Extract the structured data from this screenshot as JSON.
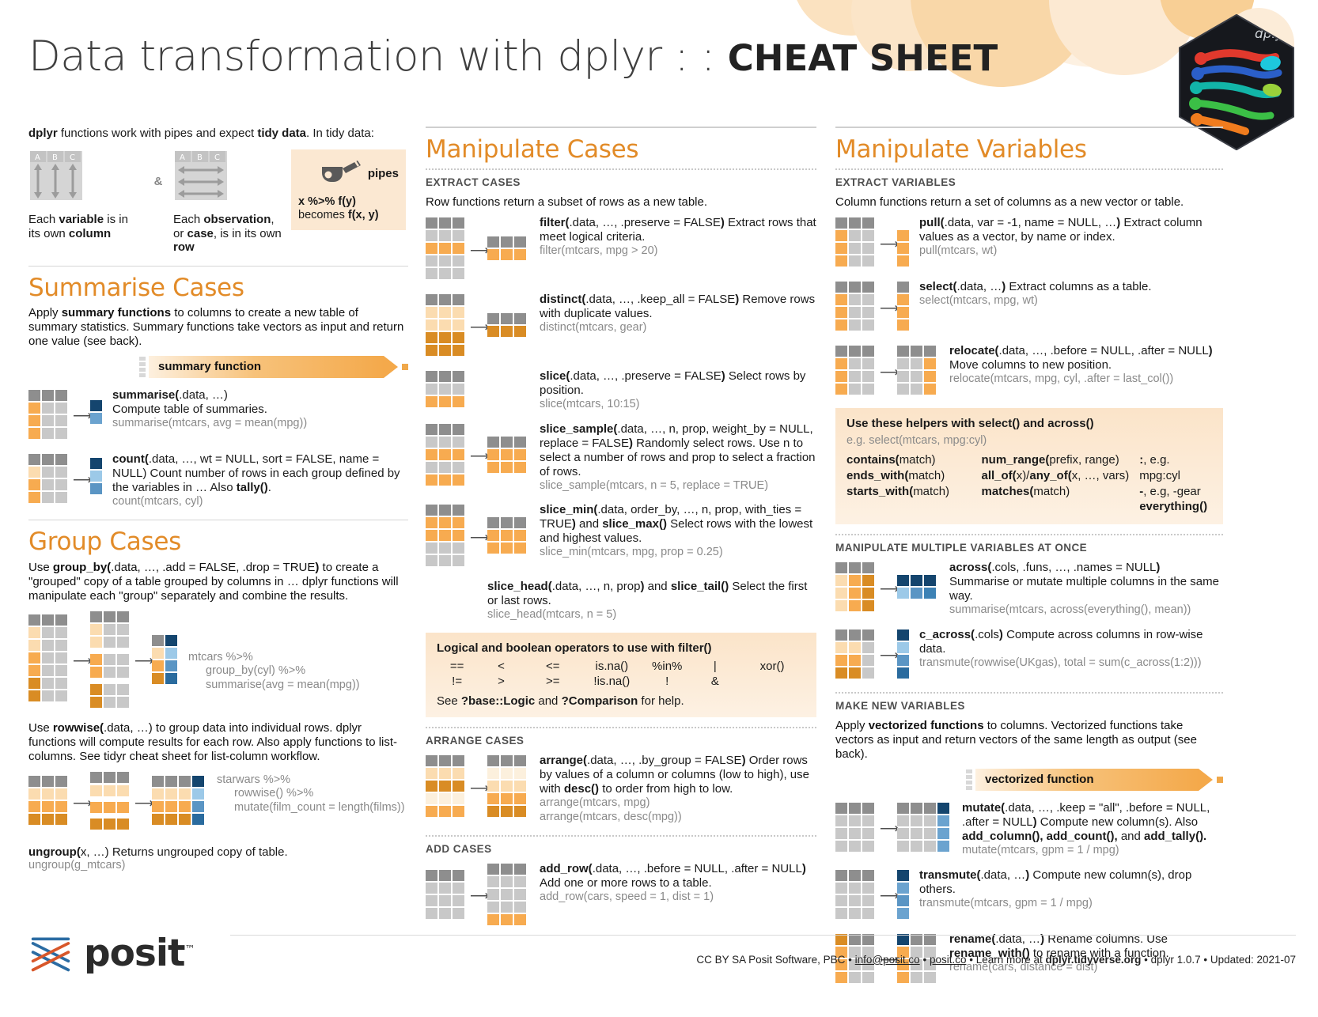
{
  "header": {
    "title_light": "Data transformation with dplyr : : ",
    "title_bold": "CHEAT SHEET",
    "logo_name": "dplyr-hex-logo"
  },
  "intro": {
    "lead_a": "dplyr",
    "lead_b": " functions work with pipes and expect ",
    "lead_c": "tidy data",
    "lead_d": ". In tidy data:",
    "variable_caption_a": "Each ",
    "variable_caption_b": "variable",
    "variable_caption_c": " is in its own ",
    "variable_caption_d": "column",
    "observation_caption_a": "Each ",
    "observation_caption_b": "observation",
    "observation_caption_c": ", or ",
    "observation_caption_d": "case",
    "observation_caption_e": ", is in its own ",
    "observation_caption_f": "row",
    "amp": "&",
    "pipes_label": "pipes",
    "pipes_line1": "x %>% f(y)",
    "pipes_line2_lite": "becomes  ",
    "pipes_line2_bold": "f(x, y)"
  },
  "summarise": {
    "heading": "Summarise Cases",
    "body_a": "Apply ",
    "body_b": "summary functions",
    "body_c": " to columns to create a new table of summary statistics. Summary functions take vectors as input and return one value (see back).",
    "banner_label": "summary function",
    "entries": [
      {
        "sig_bold": "summarise(",
        "sig_rest": ".data, …)",
        "desc": "Compute table of summaries.",
        "code": "summarise(mtcars, avg = mean(mpg))"
      },
      {
        "sig_bold": "count(",
        "sig_rest": ".data, …, wt = NULL, sort = FALSE, name = NULL",
        "sig_tail": ") Count number of rows in each group defined by the variables in … Also ",
        "sig_tail_bold": "tally()",
        "sig_tail_end": ".",
        "code": "count(mtcars, cyl)"
      }
    ]
  },
  "group": {
    "heading": "Group Cases",
    "body_a": "Use ",
    "body_b": "group_by(",
    "body_c": ".data, …, .add = FALSE, .drop = TRUE",
    "body_d": ")",
    "body_e": " to create a \"grouped\" copy of a table grouped by columns in … dplyr functions will manipulate each \"group\" separately and combine the results.",
    "code1_line1": "mtcars  %>%",
    "code1_line2": "group_by(cyl) %>%",
    "code1_line3": "summarise(avg = mean(mpg))",
    "rowwise_a": "Use ",
    "rowwise_b": "rowwise(",
    "rowwise_c": ".data, …)",
    "rowwise_d": " to group data into individual rows. dplyr functions will compute results for each row. Also apply functions to list-columns. See tidyr cheat sheet for list-column workflow.",
    "code2_line1": "starwars %>%",
    "code2_line2": "rowwise() %>%",
    "code2_line3": "mutate(film_count = length(films))",
    "ungroup_bold": "ungroup(",
    "ungroup_rest": "x, …)",
    "ungroup_desc": " Returns ungrouped copy of table.",
    "ungroup_code": "ungroup(g_mtcars)"
  },
  "manipulate_cases": {
    "heading": "Manipulate Cases",
    "extract_label": "EXTRACT CASES",
    "extract_intro": "Row functions return a subset of rows as a new table.",
    "entries": [
      {
        "sig_bold": "filter(",
        "sig_rest": ".data, …, .preserve = FALSE",
        "sig_close": ")",
        "desc": " Extract rows that meet logical criteria.",
        "code": "filter(mtcars, mpg > 20)"
      },
      {
        "sig_bold": "distinct(",
        "sig_rest": ".data, …, .keep_all = FALSE",
        "sig_close": ")",
        "desc": " Remove rows with duplicate values.",
        "code": "distinct(mtcars, gear)"
      },
      {
        "sig_bold": "slice(",
        "sig_rest": ".data, …, .preserve = FALSE",
        "sig_close": ")",
        "desc": " Select rows by position.",
        "code": "slice(mtcars, 10:15)"
      },
      {
        "sig_bold": "slice_sample(",
        "sig_rest": ".data, …, n, prop, weight_by = NULL, replace = FALSE",
        "sig_close": ")",
        "desc": " Randomly select rows. Use n to select a number of rows and prop to select a fraction of rows.",
        "code": "slice_sample(mtcars, n = 5, replace = TRUE)"
      },
      {
        "sig_bold": "slice_min(",
        "sig_rest": ".data, order_by, …, n, prop, with_ties = TRUE",
        "sig_close": ")",
        "mid": " and ",
        "sig_bold2": "slice_max()",
        "desc": " Select rows with the lowest and highest values.",
        "code": "slice_min(mtcars, mpg, prop = 0.25)"
      },
      {
        "sig_bold": "slice_head(",
        "sig_rest": ".data, …, n, prop",
        "sig_close": ")",
        "mid": " and ",
        "sig_bold2": "slice_tail()",
        "desc": " Select the first or last rows.",
        "code": "slice_head(mtcars, n = 5)"
      }
    ],
    "logic_box": {
      "title": "Logical and boolean operators to use with filter()",
      "row1": [
        "==",
        "<",
        "<=",
        "is.na()",
        "%in%",
        "|",
        "xor()"
      ],
      "row2": [
        "!=",
        ">",
        ">=",
        "!is.na()",
        "!",
        "&",
        ""
      ],
      "see_a": "See ",
      "see_b": "?base::Logic",
      "see_c": " and ",
      "see_d": "?Comparison",
      "see_e": " for help."
    },
    "arrange_label": "ARRANGE CASES",
    "arrange": {
      "sig_bold": "arrange(",
      "sig_rest": ".data, …, .by_group = FALSE",
      "sig_close": ")",
      "desc_a": " Order rows by values of a column or columns (low to high), use with ",
      "desc_b": "desc()",
      "desc_c": " to order from high to low.",
      "code1": "arrange(mtcars, mpg)",
      "code2": "arrange(mtcars, desc(mpg))"
    },
    "add_label": "ADD CASES",
    "add_row": {
      "sig_bold": "add_row(",
      "sig_rest": ".data, …, .before = NULL, .after = NULL",
      "sig_close": ")",
      "desc": "Add one or more rows to a table.",
      "code": "add_row(cars, speed = 1, dist = 1)"
    }
  },
  "manipulate_variables": {
    "heading": "Manipulate Variables",
    "extract_label": "EXTRACT VARIABLES",
    "extract_intro": "Column functions return a set of columns as a new vector or table.",
    "entries": [
      {
        "sig_bold": "pull(",
        "sig_rest": ".data,  var = -1, name = NULL, …",
        "sig_close": ")",
        "desc": " Extract column values as a vector, by name or index.",
        "code": "pull(mtcars, wt)"
      },
      {
        "sig_bold": "select(",
        "sig_rest": ".data, …",
        "sig_close": ")",
        "desc": " Extract columns as a table.",
        "code": "select(mtcars, mpg, wt)"
      },
      {
        "sig_bold": "relocate(",
        "sig_rest": ".data, …, .before = NULL, .after = NULL",
        "sig_close": ")",
        "desc": " Move columns to new position.",
        "code": "relocate(mtcars, mpg, cyl, .after = last_col())"
      }
    ],
    "helpers_box": {
      "title": "Use these helpers with select() and across()",
      "sub": "e.g. select(mtcars, mpg:cyl)",
      "col1": [
        {
          "bold": "contains(",
          "rest": "match)"
        },
        {
          "bold": "ends_with(",
          "rest": "match)"
        },
        {
          "bold": "starts_with(",
          "rest": "match)"
        }
      ],
      "col2": [
        {
          "bold": "num_range(",
          "rest": "prefix, range)"
        },
        {
          "bold": "all_of(",
          "rest": "x)/",
          "bold2": "any_of(",
          "rest2": "x, …, vars)"
        },
        {
          "bold": "matches(",
          "rest": "match)"
        }
      ],
      "col3": [
        {
          "bold": ":",
          "rest": ", e.g. mpg:cyl"
        },
        {
          "bold": "-",
          "rest": ", e.g, -gear"
        },
        {
          "bold": "everything()",
          "rest": ""
        }
      ]
    },
    "multi_label": "MANIPULATE MULTIPLE VARIABLES AT ONCE",
    "multi_entries": [
      {
        "sig_bold": "across(",
        "sig_rest": ".cols, .funs, …, .names = NULL",
        "sig_close": ")",
        "desc": " Summarise or mutate multiple columns in the same way.",
        "code": "summarise(mtcars, across(everything(), mean))"
      },
      {
        "sig_bold": "c_across(",
        "sig_rest": ".cols",
        "sig_close": ")",
        "desc": " Compute across columns in row-wise data.",
        "code": "transmute(rowwise(UKgas), total = sum(c_across(1:2)))"
      }
    ],
    "make_label": "MAKE NEW VARIABLES",
    "make_intro_a": "Apply ",
    "make_intro_b": "vectorized functions",
    "make_intro_c": " to columns. Vectorized functions take vectors as input and return vectors of the same length as output (see back).",
    "banner_label": "vectorized function",
    "make_entries": [
      {
        "sig_bold": "mutate(",
        "sig_rest": ".data, …, .keep = \"all\", .before = NULL, .after = NULL",
        "sig_close": ")",
        "desc": " Compute new column(s). Also ",
        "bold_list": "add_column(), add_count(),",
        "desc2": " and ",
        "bold_list2": "add_tally().",
        "code": "mutate(mtcars, gpm = 1 / mpg)"
      },
      {
        "sig_bold": "transmute(",
        "sig_rest": ".data, …",
        "sig_close": ")",
        "desc": " Compute new column(s), drop others.",
        "code": "transmute(mtcars, gpm = 1 / mpg)"
      },
      {
        "sig_bold": "rename(",
        "sig_rest": ".data, …",
        "sig_close": ")",
        "desc": " Rename columns. Use ",
        "bold_list": "rename_with()",
        "desc2": " to rename with a function.",
        "code": "rename(cars, distance = dist)"
      }
    ]
  },
  "footer": {
    "brand": "posit",
    "tm": "™",
    "license": "CC BY SA Posit Software, PBC",
    "sep": "•",
    "email": "info@posit.co",
    "site": "posit.co",
    "learn_more": "Learn more at ",
    "learn_link": "dplyr.tidyverse.org",
    "pkg": "dplyr  1.0.7",
    "updated": "Updated:  2021-07"
  },
  "colors": {
    "accent": "#e28b28",
    "orange_light": "#fbe8d2",
    "grey_cell": "#c8c8c8",
    "dark_grey_cell": "#8e8e8e",
    "blue_dark": "#14456e",
    "blue_mid": "#3d82b5",
    "blue_light": "#9cc9e8"
  }
}
